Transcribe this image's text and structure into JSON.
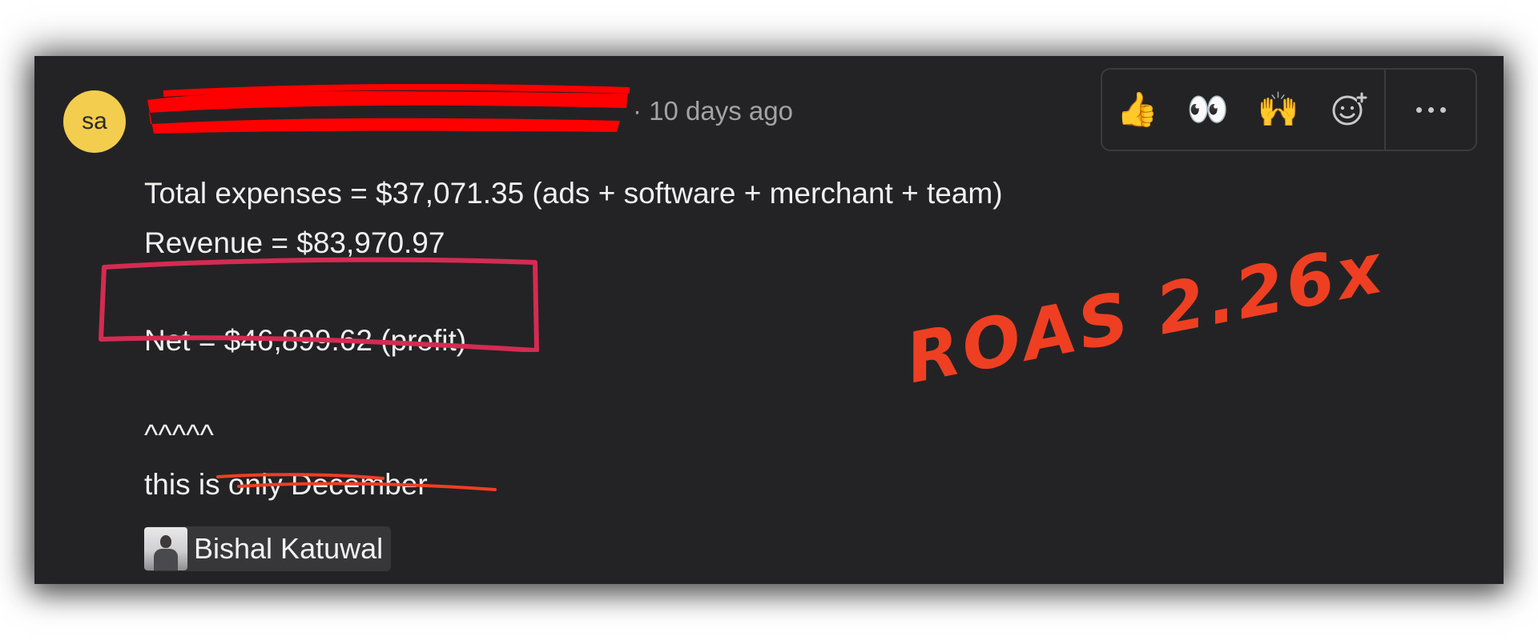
{
  "comment": {
    "avatar_initials": "sa",
    "author_redacted": "s**********@gmail.com",
    "timestamp": "· 10 days ago",
    "lines": [
      "Total expenses = $37,071.35 (ads + software + merchant + team)",
      "Revenue = $83,970.97",
      "Net = $46,899.62 (profit)",
      "^^^^^",
      "this is only December"
    ],
    "mention_name": "Bishal Katuwal"
  },
  "toolbar": {
    "reactions": [
      {
        "icon": "thumbs-up-icon",
        "glyph": "👍"
      },
      {
        "icon": "eyes-icon",
        "glyph": "👀"
      },
      {
        "icon": "raised-hands-icon",
        "glyph": "🙌"
      }
    ],
    "add_reaction_icon": "add-reaction-icon",
    "more_icon": "more-options-icon"
  },
  "annotations": {
    "roas_text": "ROAS 2.26x",
    "annotation_color": "#ee3f22",
    "box_color": "#d42b52"
  },
  "colors": {
    "card_bg": "#232325",
    "avatar_bg": "#f3cd4d",
    "redaction": "#ff0000"
  }
}
